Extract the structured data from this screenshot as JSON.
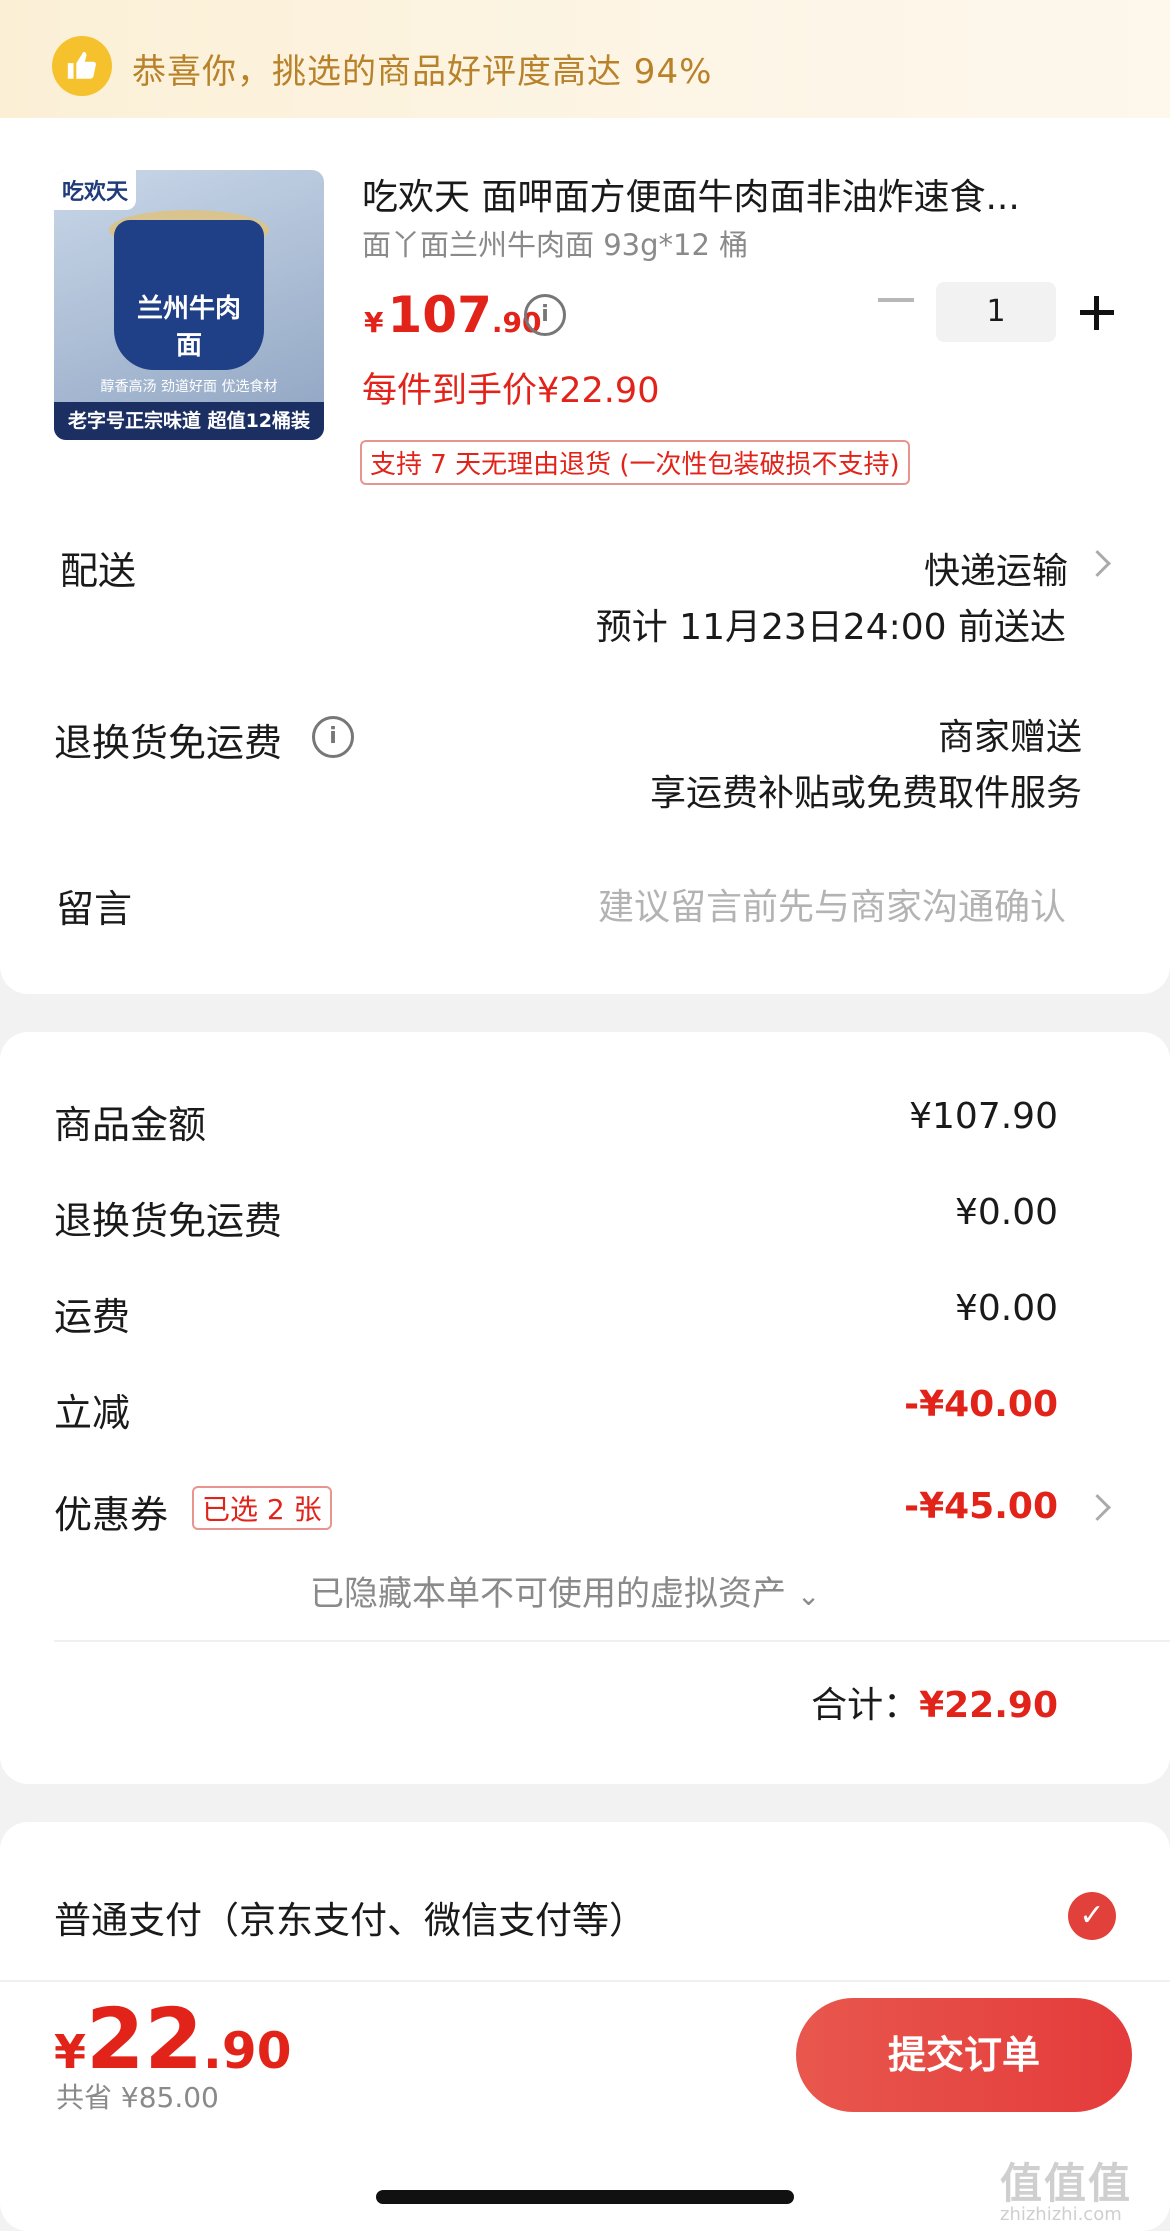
{
  "banner": {
    "text": "恭喜你，挑选的商品好评度高达 94%",
    "icon": "thumb-up-icon"
  },
  "product": {
    "image_brand": "吃欢天",
    "image_label": "兰州牛肉面",
    "image_sub": "醇香高汤 劲道好面 优选食材",
    "image_bottom": "老字号正宗味道 超值12桶装",
    "title": "吃欢天 面呷面方便面牛肉面非油炸速食...",
    "spec": "面丫面兰州牛肉面 93g*12 桶",
    "price_currency": "¥",
    "price_int": "107",
    "price_dec": ".90",
    "quantity": "1",
    "unit_price": "每件到手价¥22.90",
    "return_tag": "支持 7 天无理由退货 (一次性包装破损不支持)"
  },
  "delivery": {
    "label": "配送",
    "method": "快递运输",
    "eta": "预计 11月23日24:00 前送达"
  },
  "return_fee": {
    "label": "退换货免运费",
    "line1": "商家赠送",
    "line2": "享运费补贴或免费取件服务"
  },
  "message": {
    "label": "留言",
    "placeholder": "建议留言前先与商家沟通确认"
  },
  "summary": {
    "rows": [
      {
        "label": "商品金额",
        "value": "¥107.90"
      },
      {
        "label": "退换货免运费",
        "value": "¥0.00"
      },
      {
        "label": "运费",
        "value": "¥0.00"
      },
      {
        "label": "立减",
        "value": "-¥40.00"
      },
      {
        "label": "优惠券",
        "value": "-¥45.00"
      }
    ],
    "coupon_tag": "已选 2 张",
    "hidden_assets": "已隐藏本单不可使用的虚拟资产",
    "total_label": "合计：",
    "total_value": "¥22.90"
  },
  "payment": {
    "option": "普通支付（京东支付、微信支付等）"
  },
  "bottom": {
    "currency": "¥",
    "int": "22",
    "dec": ".90",
    "saved": "共省 ¥85.00",
    "submit": "提交订单"
  },
  "watermark": {
    "main": "值值值",
    "sub": "zhizhizhi.com"
  },
  "colors": {
    "accent": "#e2231a",
    "banner_text": "#b8822a",
    "banner_icon": "#f5c12c"
  }
}
